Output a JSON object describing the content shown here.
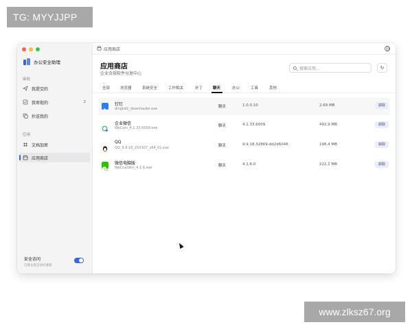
{
  "watermarks": {
    "top": "TG: MYYJJPP",
    "bottom": "www.zlksz67.org"
  },
  "sidebar": {
    "brand": "办公安全助理",
    "section_approval": "审批",
    "items_approval": [
      {
        "label": "我提交的",
        "icon": "send-icon"
      },
      {
        "label": "我审批的",
        "icon": "check-square-icon",
        "count": "2"
      },
      {
        "label": "抄送我的",
        "icon": "copy-icon"
      }
    ],
    "section_apps": "应用",
    "items_apps": [
      {
        "label": "文档加密",
        "icon": "grid-icon"
      },
      {
        "label": "应用商店",
        "icon": "store-icon"
      }
    ],
    "secure": {
      "title": "安全访问",
      "subtitle": "已建立安全访问通道",
      "enabled": true
    }
  },
  "topbar": {
    "title": "应用商店"
  },
  "header": {
    "title": "应用商店",
    "subtitle": "企业合规软件分发中心",
    "search_placeholder": "搜索应用..."
  },
  "tabs": [
    "全部",
    "浏览器",
    "系统安全",
    "工作相关",
    "补丁",
    "聊天",
    "办公",
    "工具",
    "其他"
  ],
  "active_tab": "聊天",
  "apps": [
    {
      "name": "钉钉",
      "file": "dingtalk_downloader.exe",
      "category": "聊天",
      "version": "1.0.0.10",
      "size": "2.69 MB",
      "action": "获取",
      "color": "#2f7cf6"
    },
    {
      "name": "企业微信",
      "file": "WeCom_4.1.33.6009.exe",
      "category": "聊天",
      "version": "4.1.33.6009",
      "size": "492.9 MB",
      "action": "获取",
      "color": "#2aae67"
    },
    {
      "name": "QQ",
      "file": "QQ_9.9.18_250307_x64_01.exe",
      "category": "聊天",
      "version": "9.9.18.32869-dd2d6046",
      "size": "198.4 MB",
      "action": "获取",
      "color": "#222222"
    },
    {
      "name": "微信电脑版",
      "file": "WeChatWin_4.1.6.exe",
      "category": "聊天",
      "version": "4.1.6.0",
      "size": "222.1 MB",
      "action": "获取",
      "color": "#2dc100"
    }
  ]
}
